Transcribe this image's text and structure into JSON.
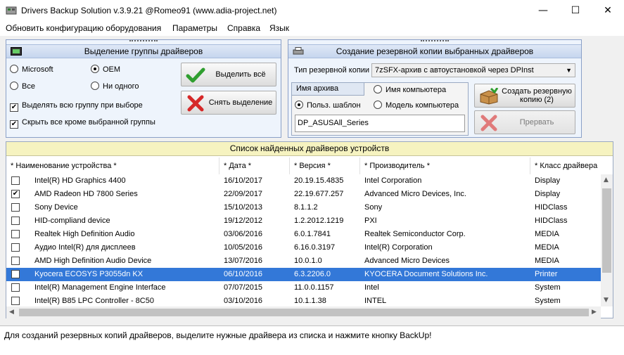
{
  "window": {
    "title": "Drivers Backup Solution v.3.9.21 @Romeo91 (www.adia-project.net)",
    "minimize": "—",
    "maximize": "☐",
    "close": "✕"
  },
  "menu": [
    "Обновить конфигурацию оборудования",
    "Параметры",
    "Справка",
    "Язык"
  ],
  "group_panel": {
    "title": "Выделение группы драйверов",
    "radio_microsoft": "Microsoft",
    "radio_oem": "OEM",
    "radio_all": "Все",
    "radio_none": "Ни одного",
    "check_select_group": "Выделять всю группу при выборе",
    "check_hide_others": "Скрыть все кроме выбранной группы",
    "select_all_button": "Выделить всё",
    "deselect_button": "Снять выделение"
  },
  "backup_panel": {
    "title": "Создание резервной копии выбранных драйверов",
    "type_label": "Тип резервной копии",
    "type_value": "7zSFX-архив с автоустановкой через DPInst",
    "archive_name_label": "Имя архива",
    "radio_computer_name": "Имя компьютера",
    "radio_user_template": "Польз. шаблон",
    "radio_computer_model": "Модель компьютера",
    "archive_name_value": "DP_ASUSAll_Series",
    "create_button": "Создать резервную копию (2)",
    "abort_button": "Прервать"
  },
  "driver_list": {
    "title": "Список найденных драйверов устройств",
    "columns": [
      "* Наименование устройства *",
      "* Дата *",
      "* Версия *",
      "* Производитель *",
      "* Класс драйвера"
    ],
    "rows": [
      {
        "checked": false,
        "name": "Intel(R) HD Graphics 4400",
        "date": "16/10/2017",
        "version": "20.19.15.4835",
        "vendor": "Intel Corporation",
        "class": "Display",
        "selected": false
      },
      {
        "checked": true,
        "name": "AMD Radeon HD 7800 Series",
        "date": "22/09/2017",
        "version": "22.19.677.257",
        "vendor": "Advanced Micro Devices, Inc.",
        "class": "Display",
        "selected": false
      },
      {
        "checked": false,
        "name": "Sony Device",
        "date": "15/10/2013",
        "version": "8.1.1.2",
        "vendor": "Sony",
        "class": "HIDClass",
        "selected": false
      },
      {
        "checked": false,
        "name": "HID-compliand device",
        "date": "19/12/2012",
        "version": "1.2.2012.1219",
        "vendor": "PXI",
        "class": "HIDClass",
        "selected": false
      },
      {
        "checked": false,
        "name": "Realtek High Definition Audio",
        "date": "03/06/2016",
        "version": "6.0.1.7841",
        "vendor": "Realtek Semiconductor Corp.",
        "class": "MEDIA",
        "selected": false
      },
      {
        "checked": false,
        "name": "Аудио Intel(R) для дисплеев",
        "date": "10/05/2016",
        "version": "6.16.0.3197",
        "vendor": "Intel(R) Corporation",
        "class": "MEDIA",
        "selected": false
      },
      {
        "checked": false,
        "name": "AMD High Definition Audio Device",
        "date": "13/07/2016",
        "version": "10.0.1.0",
        "vendor": "Advanced Micro Devices",
        "class": "MEDIA",
        "selected": false
      },
      {
        "checked": true,
        "name": "Kyocera ECOSYS P3055dn KX",
        "date": "06/10/2016",
        "version": "6.3.2206.0",
        "vendor": "KYOCERA Document Solutions Inc.",
        "class": "Printer",
        "selected": true
      },
      {
        "checked": false,
        "name": "Intel(R) Management Engine Interface",
        "date": "07/07/2015",
        "version": "11.0.0.1157",
        "vendor": "Intel",
        "class": "System",
        "selected": false
      },
      {
        "checked": false,
        "name": "Intel(R) B85 LPC Controller - 8C50",
        "date": "03/10/2016",
        "version": "10.1.1.38",
        "vendor": "INTEL",
        "class": "System",
        "selected": false
      }
    ]
  },
  "status": "Для созданий резервных копий драйверов, выделите нужные драйвера из списка и нажмите кнопку BackUp!",
  "colors": {
    "selection": "#3378d8",
    "list_title_bg": "#f6f3c0",
    "panel_bg": "#eef4fc"
  }
}
